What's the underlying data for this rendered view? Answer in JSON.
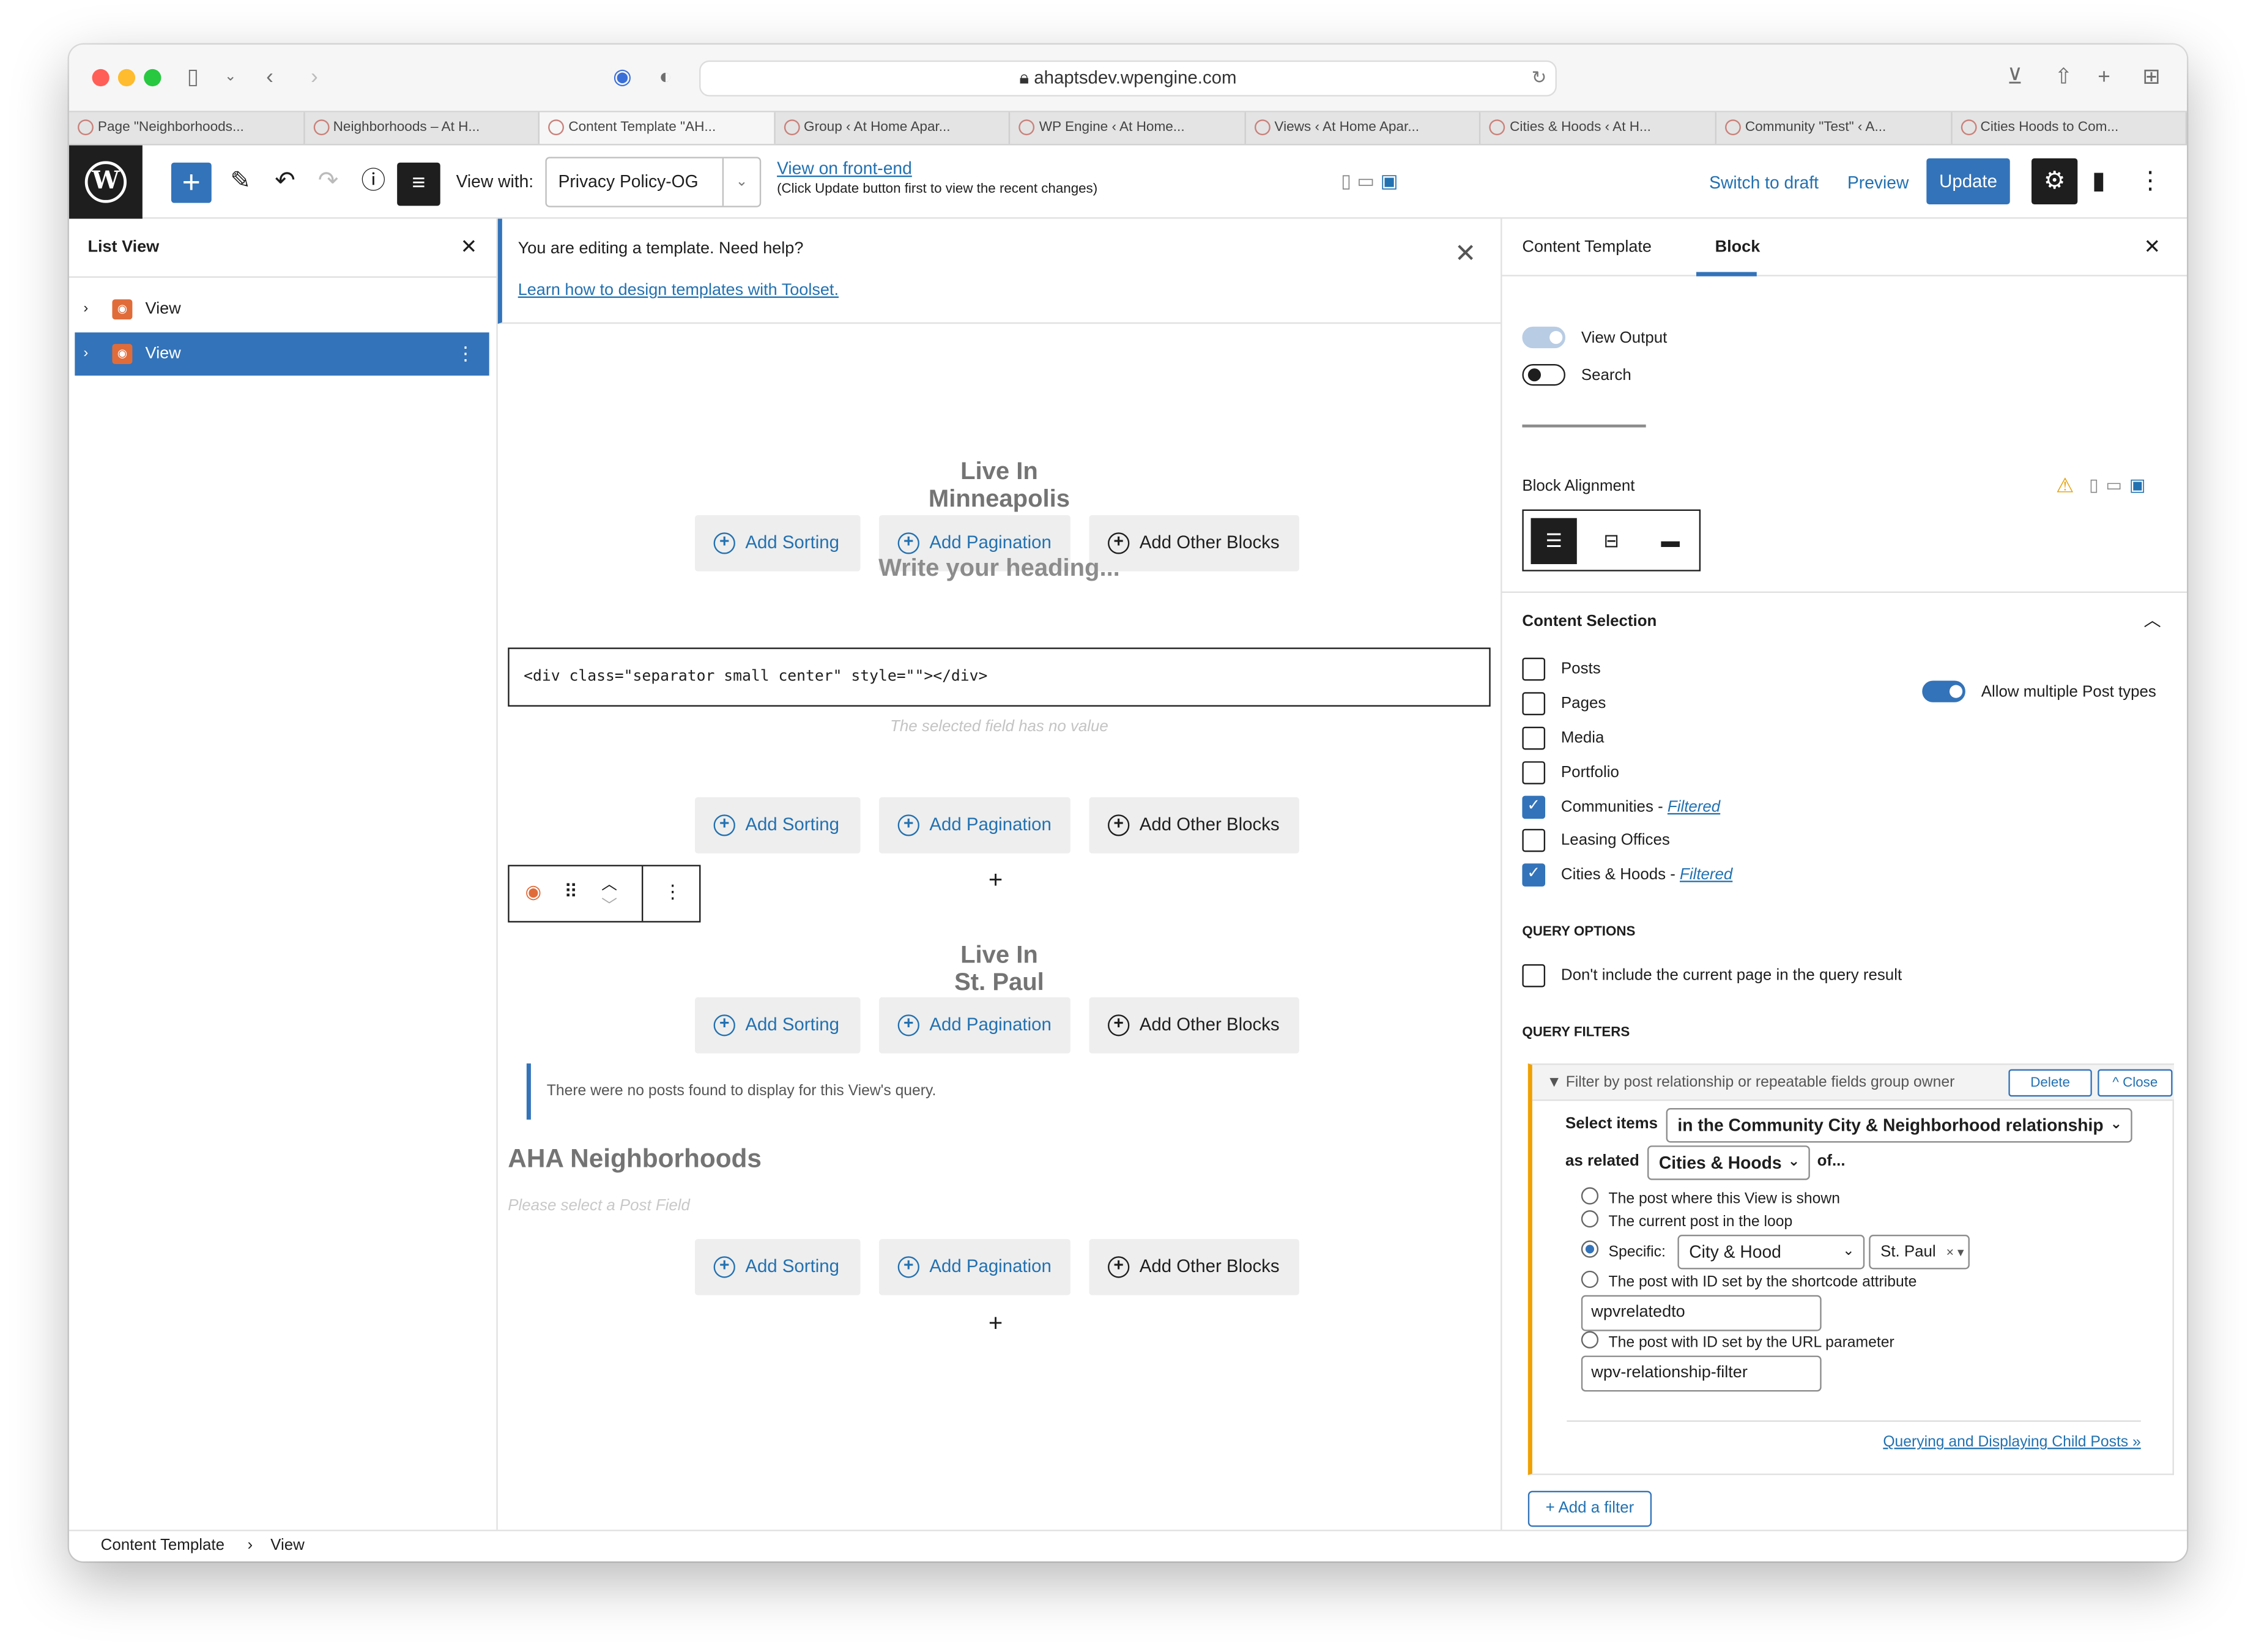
{
  "browser": {
    "url": "ahaptsdev.wpengine.com",
    "tabs": [
      "Page \"Neighborhoods...",
      "Neighborhoods – At H...",
      "Content Template \"AH...",
      "Group ‹ At Home Apar...",
      "WP Engine ‹ At Home...",
      "Views ‹ At Home Apar...",
      "Cities & Hoods ‹ At H...",
      "Community \"Test\" ‹ A...",
      "Cities Hoods to Com..."
    ],
    "active_tab": 2
  },
  "toolbar": {
    "view_with_label": "View with:",
    "view_with_value": "Privacy Policy-OG",
    "front_end_link": "View on front-end",
    "front_end_note": "(Click Update button first to view the recent changes)",
    "switch_draft": "Switch to draft",
    "preview": "Preview",
    "update": "Update"
  },
  "list_view": {
    "title": "List View",
    "items": [
      {
        "label": "View",
        "selected": false
      },
      {
        "label": "View",
        "selected": true
      }
    ]
  },
  "canvas": {
    "notice_text": "You are editing a template. Need help?",
    "notice_link": "Learn how to design templates with Toolset.",
    "heading1_line1": "Live In",
    "heading1_line2": "Minneapolis",
    "heading2_line1": "Live In",
    "heading2_line2": "St. Paul",
    "btn_sorting": "Add Sorting",
    "btn_pagination": "Add Pagination",
    "btn_other": "Add Other Blocks",
    "write_heading": "Write your heading...",
    "code": "<div class=\"separator  small center\" style=\"\"></div>",
    "no_value": "The selected field has no value",
    "no_posts": "There were no posts found to display for this View's query.",
    "aha_heading": "AHA Neighborhoods",
    "select_post_field": "Please select a Post Field"
  },
  "sidebar": {
    "tab_template": "Content Template",
    "tab_block": "Block",
    "view_output": "View Output",
    "search": "Search",
    "block_alignment": "Block Alignment",
    "content_selection": "Content Selection",
    "post_types": [
      {
        "label": "Posts",
        "checked": false,
        "filtered": ""
      },
      {
        "label": "Pages",
        "checked": false,
        "filtered": ""
      },
      {
        "label": "Media",
        "checked": false,
        "filtered": ""
      },
      {
        "label": "Portfolio",
        "checked": false,
        "filtered": ""
      },
      {
        "label": "Communities - ",
        "checked": true,
        "filtered": "Filtered"
      },
      {
        "label": "Leasing Offices",
        "checked": false,
        "filtered": ""
      },
      {
        "label": "Cities & Hoods - ",
        "checked": true,
        "filtered": "Filtered"
      }
    ],
    "allow_multiple": "Allow multiple Post types",
    "query_options": "QUERY OPTIONS",
    "dont_include": "Don't include the current page in the query result",
    "query_filters": "QUERY FILTERS",
    "filter_title": "Filter by post relationship or repeatable fields group owner",
    "delete": "Delete",
    "close": "Close",
    "select_items_label": "Select items",
    "select_items_value": "in the Community City & Neighborhood relationship",
    "as_related_label": "as related",
    "as_related_value": "Cities & Hoods",
    "of_label": "of...",
    "opt_shown": "The post where this View is shown",
    "opt_loop": "The current post in the loop",
    "opt_specific": "Specific:",
    "specific_type": "City & Hood",
    "specific_value": "St. Paul",
    "opt_shortcode": "The post with ID set by the shortcode attribute",
    "shortcode_value": "wpvrelatedto",
    "opt_url": "The post with ID set by the URL parameter",
    "url_value": "wpv-relationship-filter",
    "child_link": "Querying and Displaying Child Posts »",
    "add_filter": "+ Add a filter"
  },
  "footer": {
    "crumb1": "Content Template",
    "crumb2": "View"
  }
}
